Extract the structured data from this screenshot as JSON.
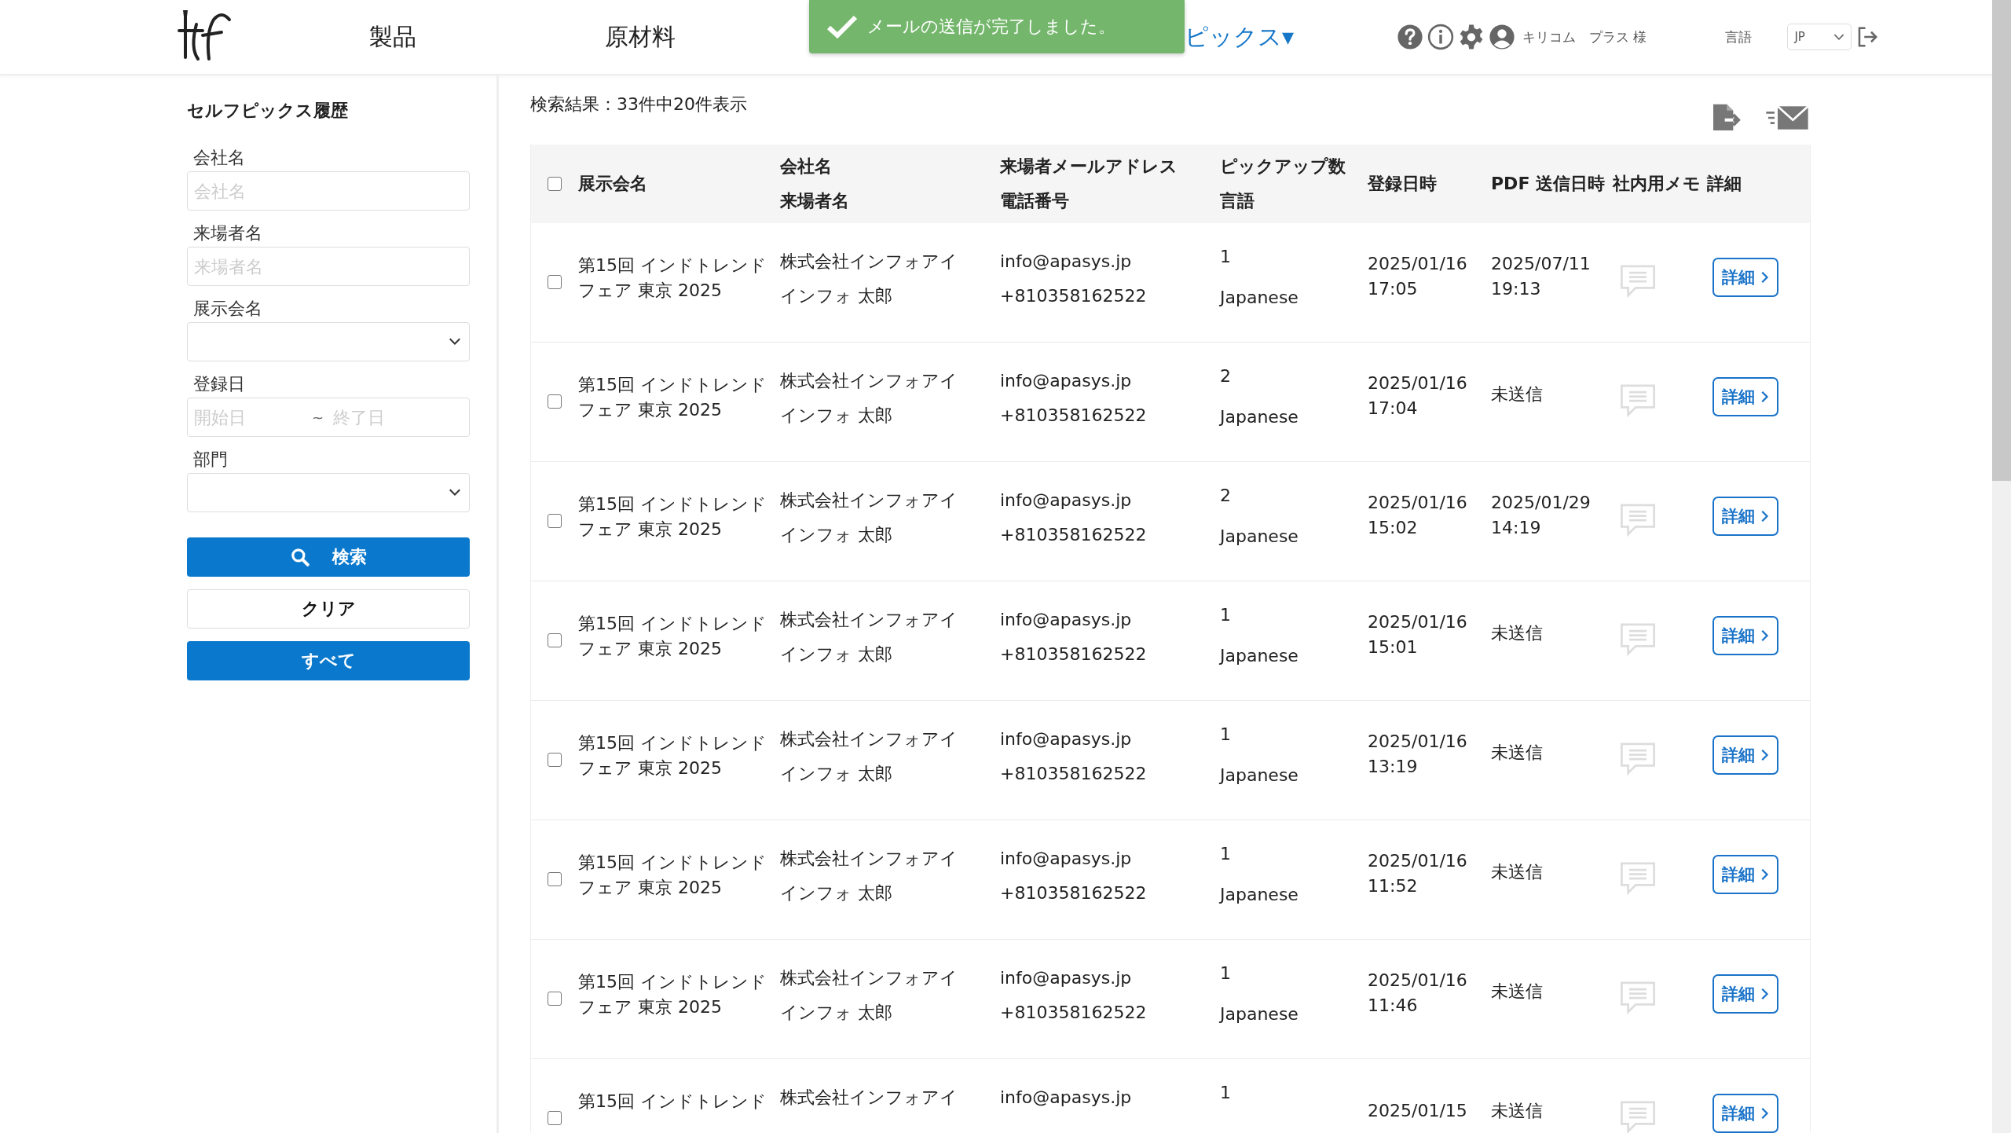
{
  "header": {
    "nav": [
      {
        "label": "製品",
        "selected": false
      },
      {
        "label": "原材料",
        "selected": false
      },
      {
        "label": "ピックス▾",
        "selected": true
      }
    ],
    "user": "キリコム　プラス 様",
    "language_label": "言語",
    "language": "JP"
  },
  "toast": {
    "message": "メールの送信が完了しました。"
  },
  "sidebar": {
    "title": "セルフピックス履歴",
    "fields": [
      {
        "kind": "text",
        "label": "会社名",
        "placeholder": "会社名"
      },
      {
        "kind": "text",
        "label": "来場者名",
        "placeholder": "来場者名"
      },
      {
        "kind": "select",
        "label": "展示会名"
      },
      {
        "kind": "range",
        "label": "登録日",
        "placeholder": "開始日",
        "separator": "~",
        "placeholder_end": "終了日"
      },
      {
        "kind": "select",
        "label": "部門"
      }
    ],
    "buttons": [
      {
        "kind": "search",
        "label": "検索"
      },
      {
        "kind": "plain",
        "label": "クリア"
      },
      {
        "kind": "primary",
        "label": "すべて"
      }
    ]
  },
  "results": {
    "summary": "検索結果：33件中20件表示",
    "columns": [
      {
        "top": "展示会名"
      },
      {
        "top": "会社名",
        "bottom": "来場者名"
      },
      {
        "top": "来場者メールアドレス",
        "bottom": "電話番号"
      },
      {
        "top": "ピックアップ数",
        "bottom": "言語"
      },
      {
        "top": "登録日時"
      },
      {
        "top": "PDF 送信日時"
      },
      {
        "top": "社内用メモ"
      },
      {
        "top": "詳細"
      }
    ],
    "header_checked": false,
    "rows": [
      {
        "checked": false,
        "exhibition": "第15回 インドトレンドフェア 東京 2025",
        "company": "株式会社インフォアイ",
        "visitor": "インフォ 太郎",
        "email": "info@apasys.jp",
        "phone": "+810358162522",
        "pickups": "1",
        "language": "Japanese",
        "registered": [
          "2025/01/16",
          "17:05"
        ],
        "pdf_sent": [
          "2025/07/11",
          "19:13"
        ],
        "detail": "詳細"
      },
      {
        "checked": false,
        "exhibition": "第15回 インドトレンドフェア 東京 2025",
        "company": "株式会社インフォアイ",
        "visitor": "インフォ 太郎",
        "email": "info@apasys.jp",
        "phone": "+810358162522",
        "pickups": "2",
        "language": "Japanese",
        "registered": [
          "2025/01/16",
          "17:04"
        ],
        "pdf_sent": [
          "未送信"
        ],
        "detail": "詳細"
      },
      {
        "checked": false,
        "exhibition": "第15回 インドトレンドフェア 東京 2025",
        "company": "株式会社インフォアイ",
        "visitor": "インフォ 太郎",
        "email": "info@apasys.jp",
        "phone": "+810358162522",
        "pickups": "2",
        "language": "Japanese",
        "registered": [
          "2025/01/16",
          "15:02"
        ],
        "pdf_sent": [
          "2025/01/29",
          "14:19"
        ],
        "detail": "詳細"
      },
      {
        "checked": false,
        "exhibition": "第15回 インドトレンドフェア 東京 2025",
        "company": "株式会社インフォアイ",
        "visitor": "インフォ 太郎",
        "email": "info@apasys.jp",
        "phone": "+810358162522",
        "pickups": "1",
        "language": "Japanese",
        "registered": [
          "2025/01/16",
          "15:01"
        ],
        "pdf_sent": [
          "未送信"
        ],
        "detail": "詳細"
      },
      {
        "checked": false,
        "exhibition": "第15回 インドトレンドフェア 東京 2025",
        "company": "株式会社インフォアイ",
        "visitor": "インフォ 太郎",
        "email": "info@apasys.jp",
        "phone": "+810358162522",
        "pickups": "1",
        "language": "Japanese",
        "registered": [
          "2025/01/16",
          "13:19"
        ],
        "pdf_sent": [
          "未送信"
        ],
        "detail": "詳細"
      },
      {
        "checked": false,
        "exhibition": "第15回 インドトレンドフェア 東京 2025",
        "company": "株式会社インフォアイ",
        "visitor": "インフォ 太郎",
        "email": "info@apasys.jp",
        "phone": "+810358162522",
        "pickups": "1",
        "language": "Japanese",
        "registered": [
          "2025/01/16",
          "11:52"
        ],
        "pdf_sent": [
          "未送信"
        ],
        "detail": "詳細"
      },
      {
        "checked": false,
        "exhibition": "第15回 インドトレンドフェア 東京 2025",
        "company": "株式会社インフォアイ",
        "visitor": "インフォ 太郎",
        "email": "info@apasys.jp",
        "phone": "+810358162522",
        "pickups": "1",
        "language": "Japanese",
        "registered": [
          "2025/01/16",
          "11:46"
        ],
        "pdf_sent": [
          "未送信"
        ],
        "detail": "詳細"
      },
      {
        "checked": false,
        "exhibition": "第15回 インドトレンド",
        "company": "株式会社インフォアイ",
        "email": "info@apasys.jp",
        "pickups": "1",
        "registered": [
          "2025/01/15"
        ],
        "pdf_sent": [
          "未送信"
        ],
        "detail": "詳細"
      }
    ]
  }
}
